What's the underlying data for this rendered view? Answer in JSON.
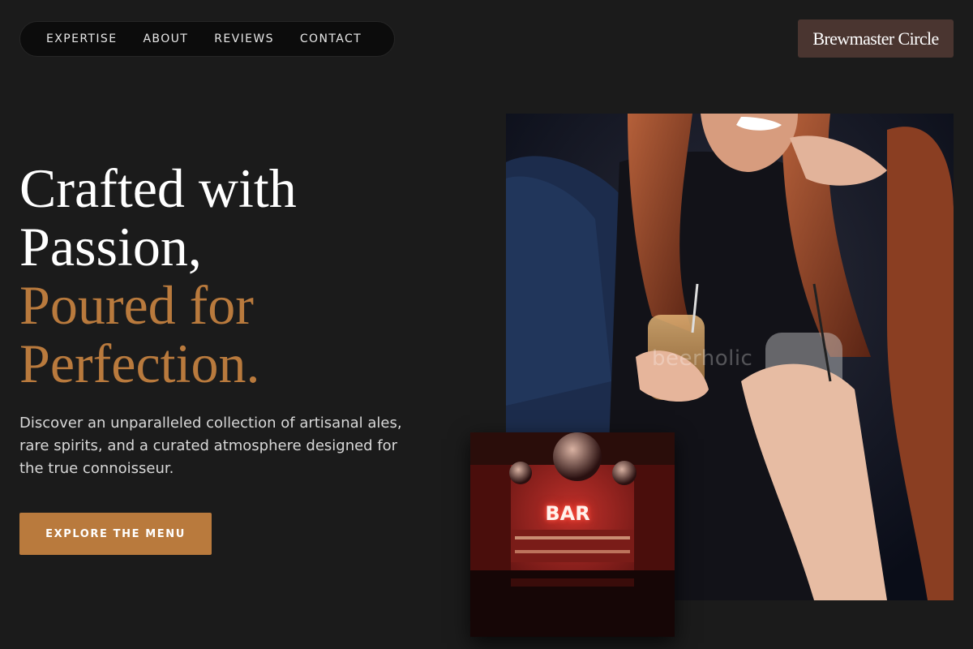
{
  "nav": {
    "items": [
      {
        "label": "EXPERTISE"
      },
      {
        "label": "ABOUT"
      },
      {
        "label": "REVIEWS"
      },
      {
        "label": "CONTACT"
      }
    ]
  },
  "brand": {
    "name": "Brewmaster Circle"
  },
  "hero": {
    "headline_light_1": "Crafted with",
    "headline_light_2": "Passion,",
    "headline_accent_1": "Poured for",
    "headline_accent_2": "Perfection.",
    "description": "Discover an unparalleled collection of artisanal ales, rare spirits, and a curated atmosphere designed for the true connoisseur.",
    "cta_label": "EXPLORE THE MENU"
  },
  "images": {
    "main_watermark": "beerholic",
    "bar_sign": "BAR"
  },
  "colors": {
    "background": "#1b1b1b",
    "accent": "#b97a3d",
    "brand_bg": "#4a3530",
    "nav_bg": "#0c0c0c"
  }
}
